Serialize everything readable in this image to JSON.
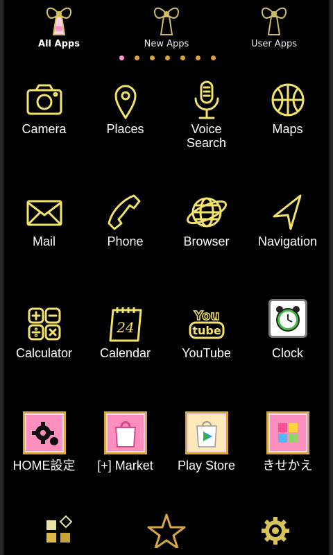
{
  "tabs": [
    {
      "label": "All Apps",
      "active": true
    },
    {
      "label": "New Apps",
      "active": false
    },
    {
      "label": "User Apps",
      "active": false
    }
  ],
  "pager": {
    "dot_count": 7,
    "active_index": 0
  },
  "apps": [
    {
      "label": "Camera",
      "icon": "camera-icon"
    },
    {
      "label": "Places",
      "icon": "location-pin-icon"
    },
    {
      "label": "Voice\nSearch",
      "icon": "microphone-icon"
    },
    {
      "label": "Maps",
      "icon": "maps-icon"
    },
    {
      "label": "Mail",
      "icon": "mail-icon"
    },
    {
      "label": "Phone",
      "icon": "phone-icon"
    },
    {
      "label": "Browser",
      "icon": "globe-icon"
    },
    {
      "label": "Navigation",
      "icon": "navigation-arrow-icon"
    },
    {
      "label": "Calculator",
      "icon": "calculator-icon"
    },
    {
      "label": "Calendar",
      "icon": "calendar-icon",
      "icon_text": "24"
    },
    {
      "label": "YouTube",
      "icon": "youtube-icon",
      "icon_text": [
        "You",
        "tube"
      ]
    },
    {
      "label": "Clock",
      "icon": "alarm-clock-icon"
    },
    {
      "label": "HOME設定",
      "icon": "home-settings-icon"
    },
    {
      "label": "[+] Market",
      "icon": "market-bag-icon"
    },
    {
      "label": "Play Store",
      "icon": "play-store-icon"
    },
    {
      "label": "きせかえ",
      "icon": "theme-puzzle-icon"
    }
  ],
  "dock": [
    {
      "icon": "app-grid-icon"
    },
    {
      "icon": "star-icon"
    },
    {
      "icon": "gear-icon"
    }
  ],
  "colors": {
    "neon": "#f4e36a",
    "neon_glow": "#b59d1d",
    "background": "#000000",
    "pink": "#ff8fbf",
    "gold": "#d7a840"
  }
}
